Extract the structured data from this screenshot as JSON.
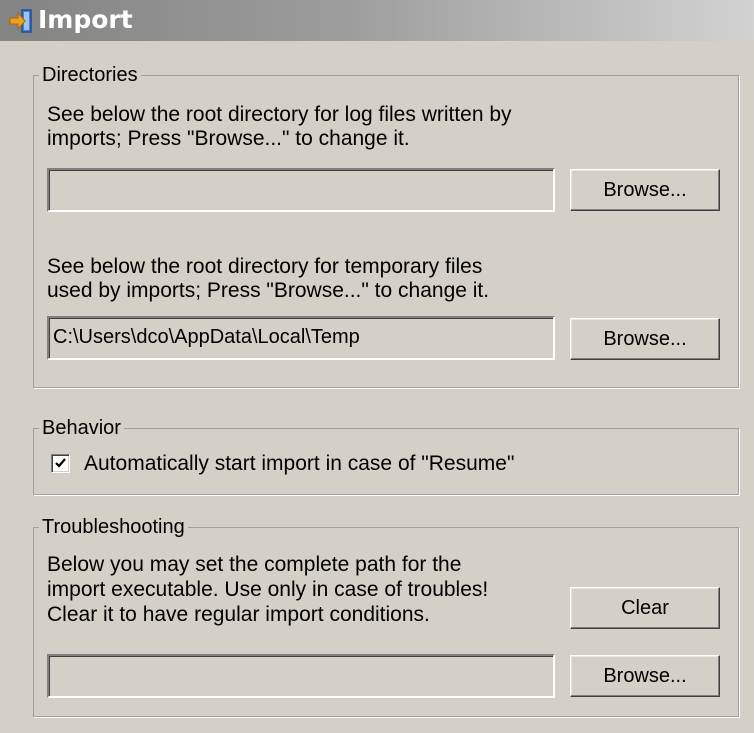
{
  "window": {
    "title": "Import",
    "title_icon": "import-arrow-icon"
  },
  "directories": {
    "legend": "Directories",
    "log_desc_line1": "See below the root directory for log files written by",
    "log_desc_line2": "imports; Press \"Browse...\" to change it.",
    "log_path_value": "",
    "log_browse_label": "Browse...",
    "temp_desc_line1": "See below the root directory for temporary files",
    "temp_desc_line2": "used by imports; Press \"Browse...\" to change it.",
    "temp_path_value": "C:\\Users\\dco\\AppData\\Local\\Temp",
    "temp_browse_label": "Browse..."
  },
  "behavior": {
    "legend": "Behavior",
    "autostart_checked": true,
    "autostart_label": "Automatically start import in case of \"Resume\""
  },
  "troubleshooting": {
    "legend": "Troubleshooting",
    "desc_line1": "Below you may set the complete path for the",
    "desc_line2": "import executable. Use only in case of troubles!",
    "desc_line3": "Clear it to have regular import conditions.",
    "clear_label": "Clear",
    "exe_path_value": "",
    "browse_label": "Browse..."
  },
  "colors": {
    "window_bg": "#d4d0c8",
    "title_text": "#ffffff",
    "title_icon_arrow": "#f0a020",
    "title_icon_door": "#4a7fd0"
  }
}
